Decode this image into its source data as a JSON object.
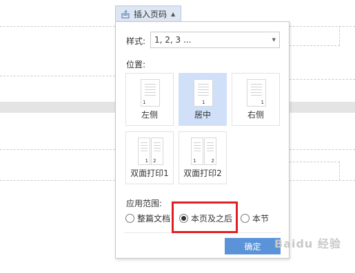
{
  "toolbar": {
    "insert_page_number_label": "插入页码"
  },
  "panel": {
    "style_label": "样式:",
    "style_value": "1, 2, 3 ...",
    "position_label": "位置:",
    "positions": [
      {
        "label": "左侧",
        "page_numbers": [
          "1"
        ],
        "selected": false
      },
      {
        "label": "居中",
        "page_numbers": [
          "1"
        ],
        "selected": true
      },
      {
        "label": "右侧",
        "page_numbers": [
          "1"
        ],
        "selected": false
      },
      {
        "label": "双面打印1",
        "page_numbers": [
          "1",
          "2"
        ],
        "selected": false
      },
      {
        "label": "双面打印2",
        "page_numbers": [
          "1",
          "2"
        ],
        "selected": false
      }
    ],
    "scope_label": "应用范围:",
    "scope_options": [
      {
        "label": "整篇文档",
        "checked": false
      },
      {
        "label": "本页及之后",
        "checked": true
      },
      {
        "label": "本节",
        "checked": false
      }
    ],
    "ok_label": "确定"
  },
  "watermark": {
    "text": "Baidu 经验"
  },
  "colors": {
    "selected_tile": "#cfe0f8",
    "ok_button": "#5b93d8",
    "highlight_box": "#e02020",
    "trigger_bg": "#dde6f3"
  }
}
